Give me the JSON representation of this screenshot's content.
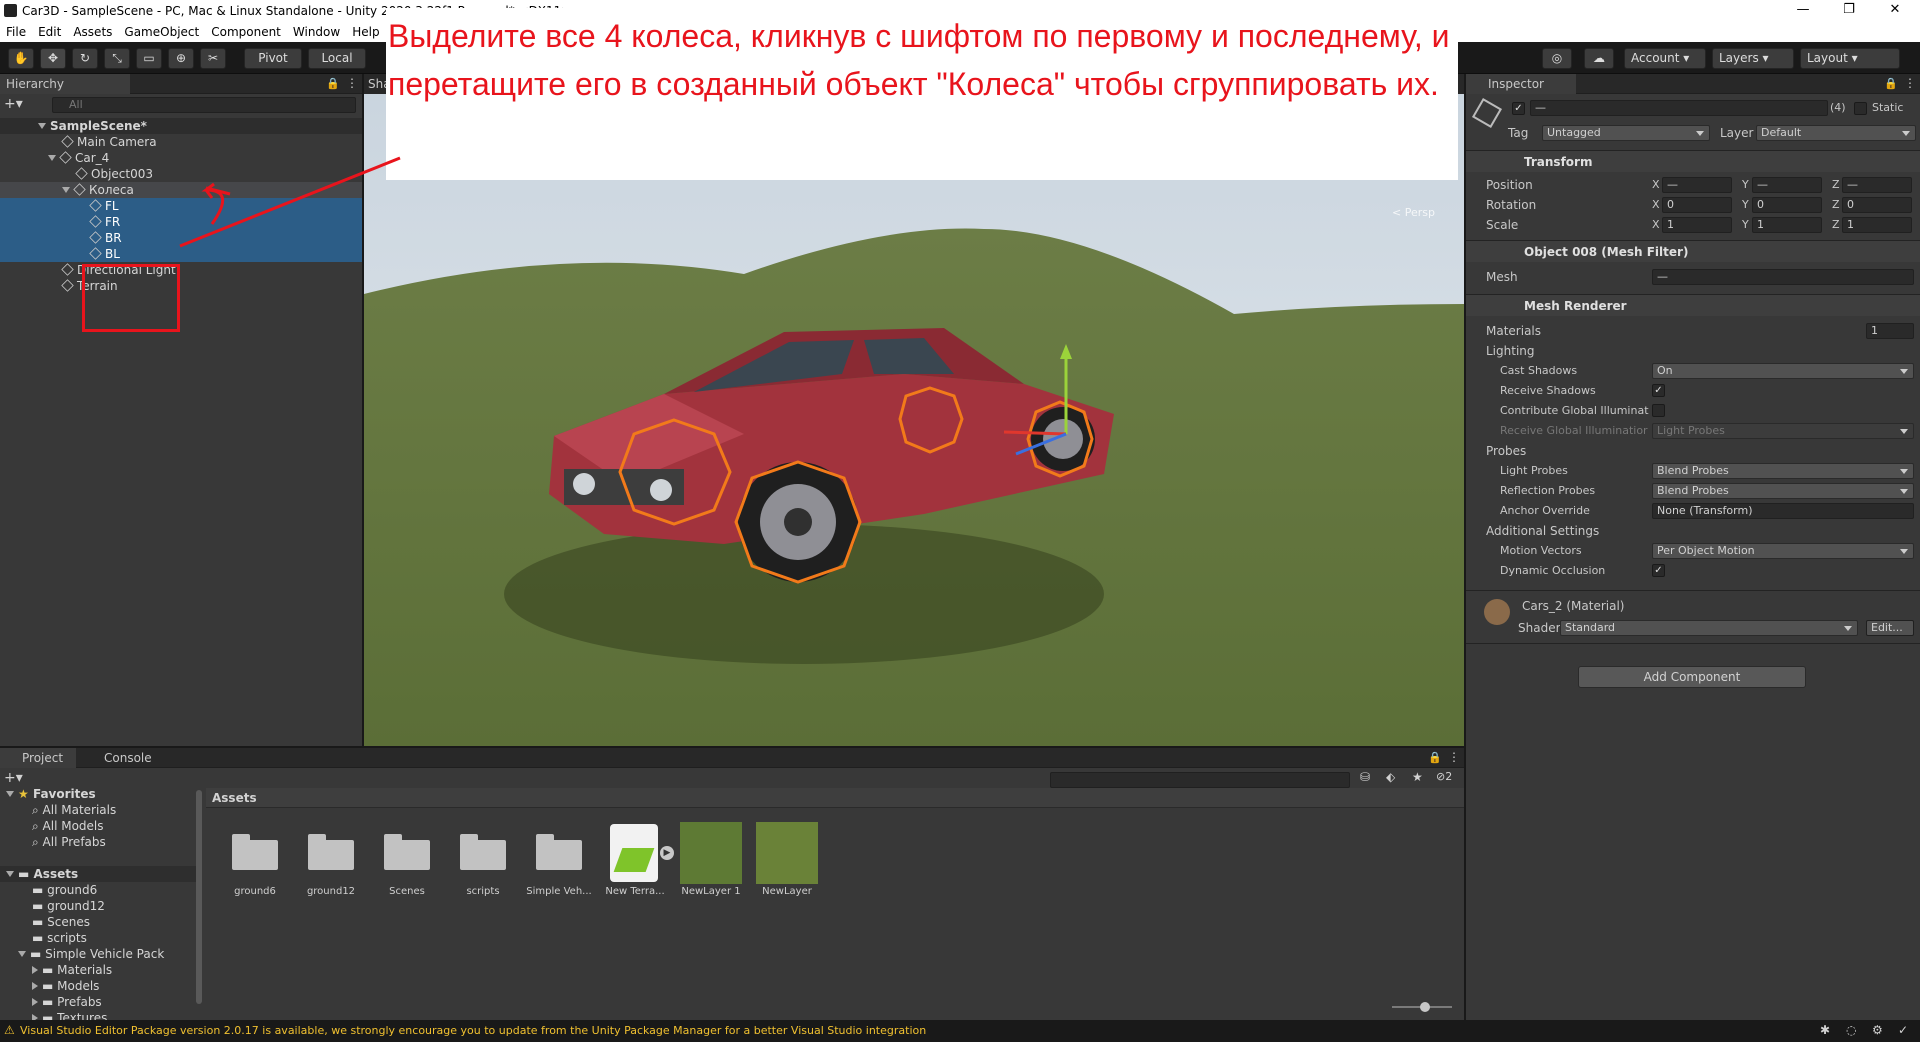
{
  "window": {
    "title": "Car3D - SampleScene - PC, Mac & Linux Standalone - Unity 2020.3.22f1 Personal* <DX11>",
    "controls": [
      "—",
      "❐",
      "✕"
    ]
  },
  "menu": [
    "File",
    "Edit",
    "Assets",
    "GameObject",
    "Component",
    "Window",
    "Help"
  ],
  "toolbar": {
    "pivot": "Pivot",
    "local": "Local",
    "account": "Account",
    "layers": "Layers",
    "layout": "Layout"
  },
  "annotation": {
    "text": "Выделите все 4 колеса, кликнув с шифтом по первому и последнему, и перетащите его в созданный объект \"Колеса\" чтобы сгруппировать их.",
    "color": "#e8141c"
  },
  "hierarchy": {
    "tab": "Hierarchy",
    "search_placeholder": "All",
    "items": [
      {
        "label": "SampleScene*"
      },
      {
        "label": "Main Camera"
      },
      {
        "label": "Car_4"
      },
      {
        "label": "Object003"
      },
      {
        "label": "Колеса"
      },
      {
        "label": "FL"
      },
      {
        "label": "FR"
      },
      {
        "label": "BR"
      },
      {
        "label": "BL"
      },
      {
        "label": "Directional Light"
      },
      {
        "label": "Terrain"
      }
    ]
  },
  "scene": {
    "tab": "Sha",
    "persp": "< Persp"
  },
  "inspector": {
    "tab": "Inspector",
    "name": "—",
    "count": "(4)",
    "static": "Static",
    "tag_label": "Tag",
    "tag": "Untagged",
    "layer_label": "Layer",
    "layer": "Default",
    "transform": {
      "title": "Transform",
      "position": "Position",
      "rotation": "Rotation",
      "scale": "Scale",
      "pos": [
        "—",
        "—",
        "—"
      ],
      "rot": [
        "0",
        "0",
        "0"
      ],
      "scl": [
        "1",
        "1",
        "1"
      ]
    },
    "meshfilter": {
      "title": "Object 008 (Mesh Filter)",
      "mesh_label": "Mesh",
      "mesh": "—"
    },
    "meshrenderer": {
      "title": "Mesh Renderer",
      "materials": "Materials",
      "materials_count": "1",
      "lighting": "Lighting",
      "cast_shadows": "Cast Shadows",
      "cast_val": "On",
      "receive_shadows": "Receive Shadows",
      "contribute_gi": "Contribute Global Illuminat",
      "receive_gi": "Receive Global Illuminatior",
      "receive_gi_val": "Light Probes",
      "probes": "Probes",
      "light_probes": "Light Probes",
      "light_probes_val": "Blend Probes",
      "reflection_probes": "Reflection Probes",
      "reflection_val": "Blend Probes",
      "anchor": "Anchor Override",
      "anchor_val": "None (Transform)",
      "additional": "Additional Settings",
      "motion_vectors": "Motion Vectors",
      "motion_val": "Per Object Motion",
      "dynamic_occlusion": "Dynamic Occlusion"
    },
    "material": {
      "name": "Cars_2 (Material)",
      "shader_label": "Shader",
      "shader": "Standard",
      "edit": "Edit..."
    },
    "add_component": "Add Component"
  },
  "project": {
    "tab_project": "Project",
    "tab_console": "Console",
    "favorites": "Favorites",
    "fav_items": [
      "All Materials",
      "All Models",
      "All Prefabs"
    ],
    "assets": "Assets",
    "asset_tree": [
      "ground6",
      "ground12",
      "Scenes",
      "scripts",
      "Simple Vehicle Pack",
      "Materials",
      "Models",
      "Prefabs",
      "Textures"
    ],
    "breadcrumb": "Assets",
    "hidden_count": "2",
    "grid": [
      {
        "label": "ground6"
      },
      {
        "label": "ground12"
      },
      {
        "label": "Scenes"
      },
      {
        "label": "scripts"
      },
      {
        "label": "Simple Veh..."
      },
      {
        "label": "New Terra..."
      },
      {
        "label": "NewLayer 1"
      },
      {
        "label": "NewLayer"
      }
    ]
  },
  "status": "Visual Studio Editor Package version 2.0.17 is available, we strongly encourage you to update from the Unity Package Manager for a better Visual Studio integration"
}
